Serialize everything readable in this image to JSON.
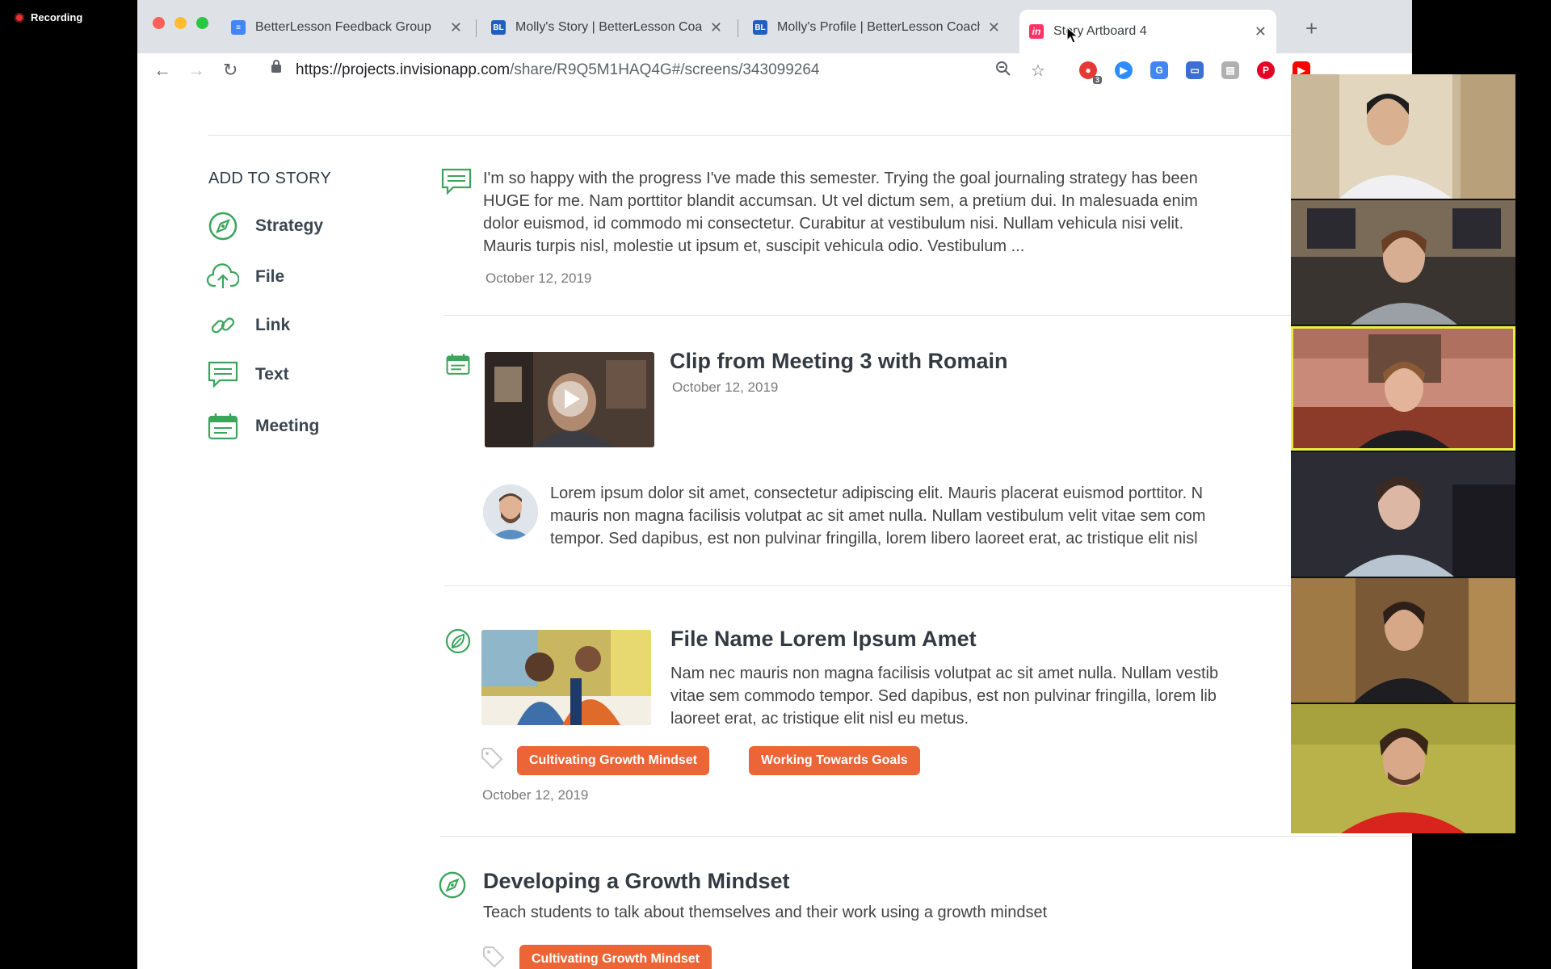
{
  "recording": {
    "label": "Recording"
  },
  "tabs": [
    {
      "title": "BetterLesson Feedback Group",
      "favicon": "docs-icon"
    },
    {
      "title": "Molly's Story | BetterLesson Coaching",
      "favicon": "bl"
    },
    {
      "title": "Molly's Profile | BetterLesson Coaching",
      "favicon": "bl"
    },
    {
      "title": "Story Artboard 4",
      "favicon": "in",
      "active": true
    }
  ],
  "favicons": {
    "bl": "BL",
    "in": "in"
  },
  "address_bar": {
    "url_host": "https://projects.invisionapp.com",
    "url_path": "/share/R9Q5M1HAQ4G#/screens/343099264"
  },
  "extensions": {
    "badge_count": "3"
  },
  "sidebar": {
    "title": "ADD TO STORY",
    "items": [
      {
        "label": "Strategy",
        "icon": "compass-icon"
      },
      {
        "label": "File",
        "icon": "upload-cloud-icon"
      },
      {
        "label": "Link",
        "icon": "link-icon"
      },
      {
        "label": "Text",
        "icon": "text-bubble-icon"
      },
      {
        "label": "Meeting",
        "icon": "calendar-icon"
      }
    ]
  },
  "feed": {
    "text_entry": {
      "lines": [
        "I'm so happy with the progress I've made this semester. Trying the goal journaling strategy has been",
        "HUGE for me. Nam porttitor blandit accumsan. Ut vel dictum sem, a pretium dui. In malesuada enim",
        "dolor euismod, id commodo mi consectetur. Curabitur at vestibulum nisi. Nullam vehicula nisi velit.",
        "Mauris turpis nisl, molestie ut ipsum et, suscipit vehicula odio. Vestibulum ..."
      ],
      "date": "October 12, 2019"
    },
    "meeting_entry": {
      "title": "Clip from Meeting 3 with Romain",
      "date": "October 12, 2019",
      "comment_lines": [
        "Lorem ipsum dolor sit amet, consectetur adipiscing elit. Mauris placerat euismod porttitor. N",
        "mauris non magna facilisis volutpat ac sit amet nulla. Nullam vestibulum velit vitae sem com",
        "tempor. Sed dapibus, est non pulvinar fringilla, lorem libero laoreet erat, ac tristique elit nisl"
      ]
    },
    "file_entry": {
      "title": "File Name Lorem Ipsum Amet",
      "lines": [
        "Nam nec mauris non magna facilisis volutpat ac sit amet nulla. Nullam vestib",
        "vitae sem commodo tempor. Sed dapibus, est non pulvinar fringilla, lorem lib",
        "laoreet erat, ac tristique elit nisl eu metus."
      ],
      "tags": [
        "Cultivating Growth Mindset",
        "Working Towards Goals"
      ],
      "date": "October 12, 2019"
    },
    "strategy_entry": {
      "title": "Developing a Growth Mindset",
      "subtitle": "Teach students to talk about themselves and their work using a growth mindset",
      "tags": [
        "Cultivating Growth Mindset"
      ]
    }
  },
  "colors": {
    "accent_green": "#3aa55b",
    "tag_orange": "#ec6536",
    "speaker_highlight": "#e6f040"
  }
}
